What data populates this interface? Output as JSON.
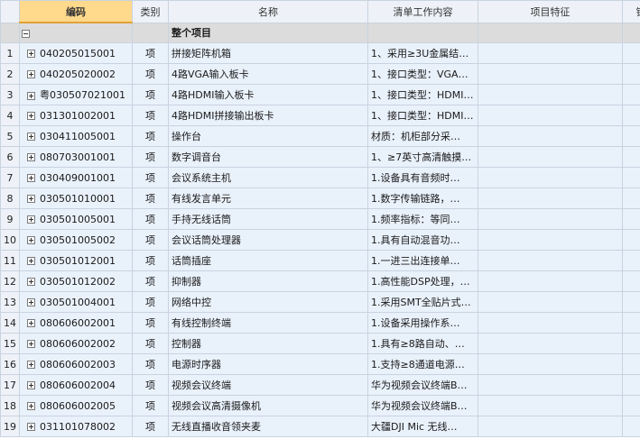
{
  "columns": [
    "",
    "编码",
    "类别",
    "名称",
    "清单工作内容",
    "项目特征",
    "锁"
  ],
  "group": {
    "title": "整个项目"
  },
  "rows": [
    {
      "num": "1",
      "code": "040205015001",
      "unit": "项",
      "name": "拼接矩阵机箱",
      "content": "1、采用≥3U金属结…"
    },
    {
      "num": "2",
      "code": "040205020002",
      "unit": "项",
      "name": "4路VGA输入板卡",
      "content": "1、接口类型：VGA…"
    },
    {
      "num": "3",
      "code": "粤030507021001",
      "unit": "项",
      "name": "4路HDMI输入板卡",
      "content": "1、接口类型：HDMI…"
    },
    {
      "num": "4",
      "code": "031301002001",
      "unit": "项",
      "name": "4路HDMI拼接输出板卡",
      "content": "1、接口类型：HDMI…"
    },
    {
      "num": "5",
      "code": "030411005001",
      "unit": "项",
      "name": "操作台",
      "content": "材质：机柜部分采…"
    },
    {
      "num": "6",
      "code": "080703001001",
      "unit": "项",
      "name": "数字调音台",
      "content": "1、≥7英寸高清触摸…"
    },
    {
      "num": "7",
      "code": "030409001001",
      "unit": "项",
      "name": "会议系统主机",
      "content": "1.设备具有音频时…"
    },
    {
      "num": "8",
      "code": "030501010001",
      "unit": "项",
      "name": "有线发言单元",
      "content": "1.数字传输链路，…"
    },
    {
      "num": "9",
      "code": "030501005001",
      "unit": "项",
      "name": "手持无线话筒",
      "content": "1.频率指标：等同…"
    },
    {
      "num": "10",
      "code": "030501005002",
      "unit": "项",
      "name": "会议话筒处理器",
      "content": "1.具有自动混音功…"
    },
    {
      "num": "11",
      "code": "030501012001",
      "unit": "项",
      "name": "话筒插座",
      "content": "1.一进三出连接单…"
    },
    {
      "num": "12",
      "code": "030501012002",
      "unit": "项",
      "name": "抑制器",
      "content": "1.高性能DSP处理，…"
    },
    {
      "num": "13",
      "code": "030501004001",
      "unit": "项",
      "name": "网络中控",
      "content": "1.采用SMT全贴片式…"
    },
    {
      "num": "14",
      "code": "080606002001",
      "unit": "项",
      "name": "有线控制终端",
      "content": "1.设备采用操作系…"
    },
    {
      "num": "15",
      "code": "080606002002",
      "unit": "项",
      "name": "控制器",
      "content": "1.具有≥8路自动、…"
    },
    {
      "num": "16",
      "code": "080606002003",
      "unit": "项",
      "name": "电源时序器",
      "content": "1.支持≥8通道电源…"
    },
    {
      "num": "17",
      "code": "080606002004",
      "unit": "项",
      "name": "视频会议终端",
      "content": "华为视频会议终端B…"
    },
    {
      "num": "18",
      "code": "080606002005",
      "unit": "项",
      "name": "视频会议高清摄像机",
      "content": "华为视频会议终端B…"
    },
    {
      "num": "19",
      "code": "031101078002",
      "unit": "项",
      "name": "无线直播收音领夹麦",
      "content": "大疆DJI Mic 无线…"
    }
  ]
}
